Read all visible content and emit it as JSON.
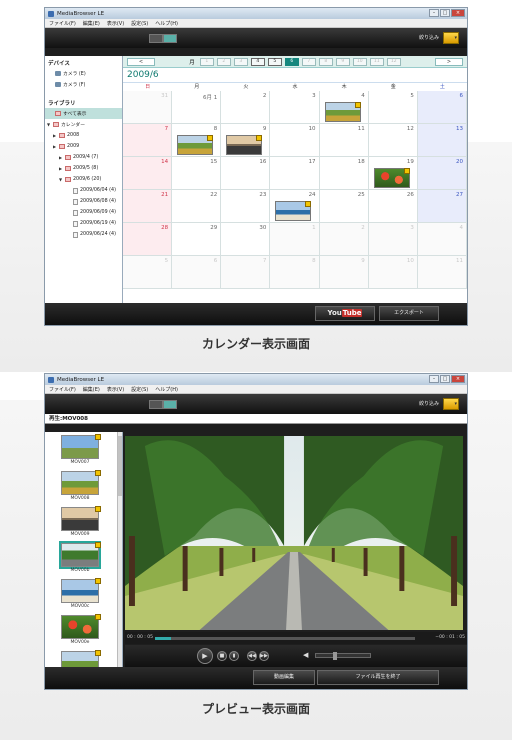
{
  "calendar_screen": {
    "caption": "カレンダー表示画面",
    "window_title": "MediaBrowser LE",
    "menu": [
      "ファイル(F)",
      "編集(E)",
      "表示(V)",
      "設定(S)",
      "ヘルプ(H)"
    ],
    "filter_label": "絞り込み",
    "sidebar": {
      "devices_header": "デバイス",
      "devices": [
        "カメラ (E)",
        "カメラ (F)"
      ],
      "library_header": "ライブラリ",
      "show_all": "すべて表示",
      "calendar": "カレンダー",
      "years": [
        "2008",
        "2009"
      ],
      "months": [
        "2009/4 (7)",
        "2009/5 (8)",
        "2009/6 (20)"
      ],
      "days": [
        "2009/06/04 (4)",
        "2009/06/08 (4)",
        "2009/06/09 (4)",
        "2009/06/19 (4)",
        "2009/06/24 (4)"
      ]
    },
    "month_nav": {
      "label": "月",
      "months": [
        "1",
        "2",
        "3",
        "4",
        "5",
        "6",
        "7",
        "8",
        "9",
        "10",
        "11",
        "12"
      ],
      "with_content": [
        "4",
        "5",
        "6"
      ],
      "current": "6",
      "prev": "<",
      "next": ">"
    },
    "year_month": "2009/6",
    "weekdays": [
      "日",
      "月",
      "火",
      "水",
      "木",
      "金",
      "土"
    ],
    "days": [
      {
        "d": "31",
        "other": true
      },
      {
        "d": "6月 1"
      },
      {
        "d": "2"
      },
      {
        "d": "3"
      },
      {
        "d": "4",
        "thumb": "field"
      },
      {
        "d": "5"
      },
      {
        "d": "6"
      },
      {
        "d": "7"
      },
      {
        "d": "8",
        "thumb": "field"
      },
      {
        "d": "9",
        "thumb": "sunset"
      },
      {
        "d": "10"
      },
      {
        "d": "11"
      },
      {
        "d": "12"
      },
      {
        "d": "13"
      },
      {
        "d": "14"
      },
      {
        "d": "15"
      },
      {
        "d": "16"
      },
      {
        "d": "17"
      },
      {
        "d": "18"
      },
      {
        "d": "19",
        "thumb": "flowers"
      },
      {
        "d": "20"
      },
      {
        "d": "21"
      },
      {
        "d": "22"
      },
      {
        "d": "23"
      },
      {
        "d": "24",
        "thumb": "sea"
      },
      {
        "d": "25"
      },
      {
        "d": "26"
      },
      {
        "d": "27"
      },
      {
        "d": "28"
      },
      {
        "d": "29"
      },
      {
        "d": "30"
      },
      {
        "d": "1",
        "other": true
      },
      {
        "d": "2",
        "other": true
      },
      {
        "d": "3",
        "other": true
      },
      {
        "d": "4",
        "other": true
      },
      {
        "d": "5",
        "other": true
      },
      {
        "d": "6",
        "other": true
      },
      {
        "d": "7",
        "other": true
      },
      {
        "d": "8",
        "other": true
      },
      {
        "d": "9",
        "other": true
      },
      {
        "d": "10",
        "other": true
      },
      {
        "d": "11",
        "other": true
      }
    ],
    "youtube_you": "You",
    "youtube_tube": "Tube",
    "export_label": "エクスポート"
  },
  "preview_screen": {
    "caption": "プレビュー表示画面",
    "window_title": "MediaBrowser LE",
    "menu": [
      "ファイル(F)",
      "編集(E)",
      "表示(V)",
      "設定(S)",
      "ヘルプ(H)"
    ],
    "filter_label": "絞り込み",
    "playing_label": "再生:MOV008",
    "thumbnails": [
      {
        "label": "MOV007",
        "kind": "sky"
      },
      {
        "label": "MOV008",
        "kind": "field"
      },
      {
        "label": "MOV009",
        "kind": "sunset"
      },
      {
        "label": "MOV00b",
        "kind": "trees",
        "selected": true
      },
      {
        "label": "MOV00c",
        "kind": "sea"
      },
      {
        "label": "MOV00e",
        "kind": "flowers"
      },
      {
        "label": "",
        "kind": "field"
      }
    ],
    "time_current": "00 : 00 : 05",
    "time_remaining": "−00 : 01 : 05",
    "progress": 0.06,
    "volume": 0.35,
    "edit_button": "動画編集",
    "end_button": "ファイル再生を終了"
  },
  "colors": {
    "accent_teal": "#16877e",
    "sunday": "#d0344a",
    "saturday": "#3a55c0"
  }
}
